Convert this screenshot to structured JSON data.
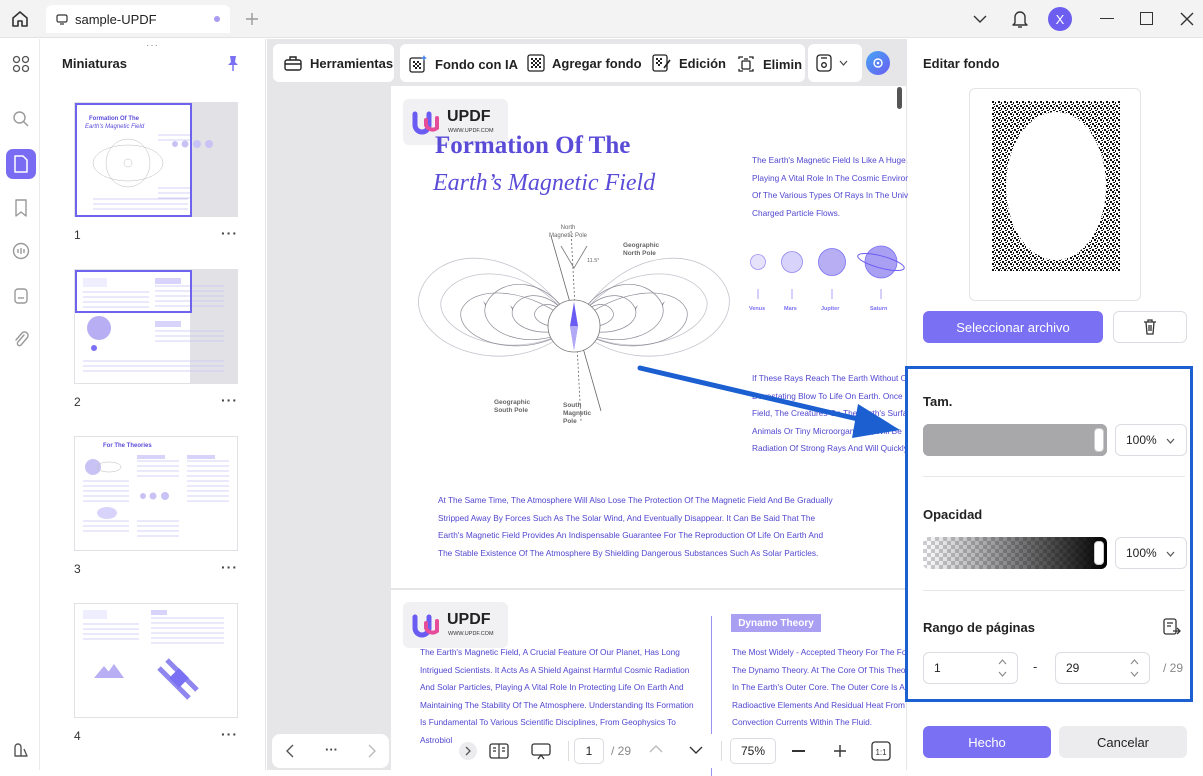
{
  "titlebar": {
    "tab_title": "sample-UPDF",
    "user_initial": "X"
  },
  "thumbnails": {
    "title": "Miniaturas",
    "pages": [
      "1",
      "2",
      "3",
      "4"
    ],
    "more": "···",
    "thumb1_title_a": "Formation Of The",
    "thumb1_title_b": "Earth's Magnetic Field",
    "thumb3_title": "For The Theories"
  },
  "toolbar": {
    "tools_label": "Herramientas",
    "ai_bg_label": "Fondo con IA",
    "add_bg_label": "Agregar fondo",
    "edit_label": "Edición",
    "remove_label": "Elimin"
  },
  "document": {
    "logo_text": "UPDF",
    "logo_sub": "WWW.UPDF.COM",
    "title_line1": "Formation Of The",
    "title_line2": "Earth’s Magnetic Field",
    "right_para_1": [
      "The Earth's Magnetic Field Is Like A Huge A",
      "Playing A Vital Role In The Cosmic Environ",
      "Of The Various Types Of Rays In The Unive",
      "Charged Particle Flows."
    ],
    "right_para_2": [
      "If These Rays Reach The Earth Without O",
      "Devastating Blow To Life On Earth. Once T",
      "Field, The Creatures On The Earth's Surfa",
      "Animals Or Tiny Microorganisms, Will Be",
      "Radiation Of Strong Rays And Will Quickly"
    ],
    "bottom_para": [
      "At The Same Time, The Atmosphere Will Also Lose The Protection Of The Magnetic Field And Be Gradually",
      "Stripped Away By Forces Such As The Solar Wind, And Eventually Disappear. It Can Be Said That The",
      "Earth's Magnetic Field Provides An Indispensable Guarantee For The Reproduction Of Life On Earth And",
      "The Stable Existence Of The Atmosphere By Shielding Dangerous Substances Such As Solar Particles."
    ],
    "labels": {
      "north_mag": "North\nMagnetic Pole",
      "geo_north": "Geographic\nNorth Pole",
      "geo_south": "Geographic\nSouth Pole",
      "south_mag": "South\nMagnetic\nPole",
      "angle": "11.5°"
    },
    "planets": [
      "Venus",
      "Mars",
      "Jupiter",
      "Saturn"
    ],
    "page2_left": [
      "The Earth's Magnetic Field, A Crucial Feature Of Our Planet, Has Long",
      "Intrigued Scientists. It Acts As A Shield Against Harmful Cosmic Radiation",
      "And Solar Particles, Playing A Vital Role In Protecting Life On Earth And",
      "Maintaining The Stability Of The Atmosphere. Understanding Its Formation",
      "Is Fundamental To Various Scientific Disciplines, From Geophysics To",
      "Astrobiol"
    ],
    "page2_badge": "Dynamo Theory",
    "page2_right": [
      "The Most Widely - Accepted Theory For The Fo",
      "The Dynamo Theory. At The Core Of This Theo",
      "In The Earth's Outer Core. The Outer Core Is A",
      "Radioactive Elements And Residual Heat From",
      "Convection Currents Within The Fluid."
    ]
  },
  "bottom_nav": {
    "more": "···",
    "page_current": "1",
    "page_total": "/ 29",
    "zoom": "75%"
  },
  "panel": {
    "title": "Editar fondo",
    "select_file": "Seleccionar archivo",
    "size_label": "Tam.",
    "size_value": "100%",
    "size_level": 1.0,
    "opacity_label": "Opacidad",
    "opacity_value": "100%",
    "opacity_level": 1.0,
    "range_label": "Rango de páginas",
    "range_from": "1",
    "range_dash": "-",
    "range_to": "29",
    "range_total": "/ 29",
    "done": "Hecho",
    "cancel": "Cancelar"
  },
  "colors": {
    "accent": "#7a70f3",
    "highlight_box": "#1b5fd0",
    "doc_text": "#5046cf"
  }
}
